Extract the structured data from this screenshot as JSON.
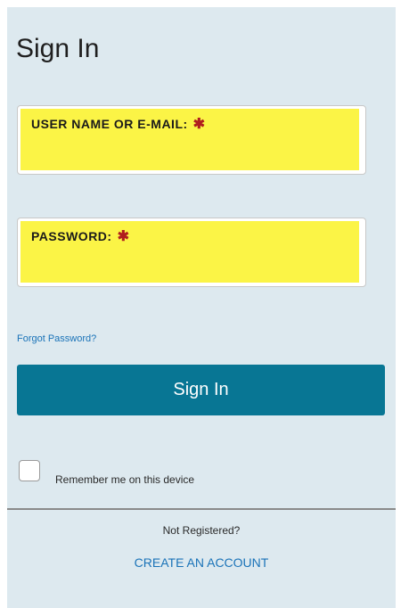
{
  "page": {
    "title": "Sign In"
  },
  "form": {
    "username_label": "USER NAME OR E-MAIL:",
    "password_label": "PASSWORD:",
    "required_marker": "✱",
    "forgot_password": "Forgot Password?",
    "signin_button": "Sign In",
    "remember_label": "Remember me on this device"
  },
  "footer": {
    "not_registered": "Not Registered?",
    "create_account": "CREATE AN ACCOUNT"
  },
  "colors": {
    "panel_bg": "#dde9ef",
    "field_highlight": "#fbf446",
    "button_bg": "#087694",
    "link": "#1a73b8",
    "required": "#b01e1e"
  },
  "icons": {
    "required": "required-asterisk-icon"
  }
}
